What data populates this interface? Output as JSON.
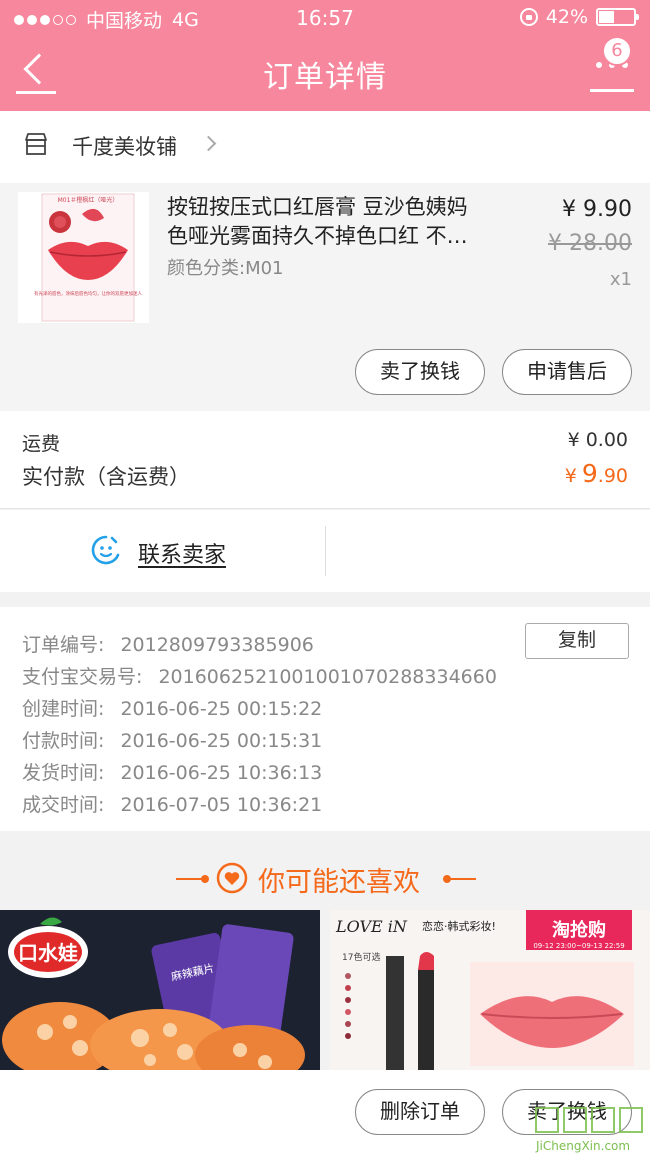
{
  "status_bar": {
    "carrier": "中国移动",
    "network": "4G",
    "time": "16:57",
    "battery": "42%",
    "battery_level": 0.42
  },
  "nav": {
    "title": "订单详情",
    "badge_count": "6"
  },
  "shop": {
    "name": "千度美妆铺"
  },
  "item": {
    "title_line1": "按钮按压式口红唇膏 豆沙色姨妈",
    "title_line2": "色哑光雾面持久不掉色口红 不…",
    "sku": "颜色分类:M01",
    "price": "¥ 9.90",
    "original_price": "¥ 28.00",
    "quantity": "x1",
    "btn_sell": "卖了换钱",
    "btn_aftersale": "申请售后",
    "thumb_header": "M01＃橙枫红（哑光）",
    "thumb_caption": "有光泽的唇色，涂抹后唇色均匀，让你的双唇更加迷人"
  },
  "fees": {
    "shipping_label": "运费",
    "shipping_value": "¥ 0.00",
    "paid_label": "实付款（含运费）",
    "paid_currency": "¥",
    "paid_int": "9",
    "paid_dec": ".90"
  },
  "contact": {
    "label": "联系卖家"
  },
  "order_info": {
    "copy_label": "复制",
    "rows": [
      {
        "label": "订单编号:",
        "value": "2012809793385906"
      },
      {
        "label": "支付宝交易号:",
        "value": "2016062521001001070288334660"
      },
      {
        "label": "创建时间:",
        "value": "2016-06-25 00:15:22"
      },
      {
        "label": "付款时间:",
        "value": "2016-06-25 00:15:31"
      },
      {
        "label": "发货时间:",
        "value": "2016-06-25 10:36:13"
      },
      {
        "label": "成交时间:",
        "value": "2016-07-05 10:36:21"
      }
    ]
  },
  "recommend": {
    "title": "你可能还喜欢",
    "p1": {
      "brand": "口水娃",
      "pack_text": "麻辣藕片"
    },
    "p2": {
      "brand": "LOVE iN",
      "slogan": "恋恋·韩式彩妆!",
      "sub": "17色可选",
      "tag": "淘抢购",
      "tag_time": "09-12 23:00~09-13 22:59"
    }
  },
  "bottom_bar": {
    "btn_delete": "删除订单",
    "btn_sell": "卖了换钱"
  },
  "watermark": {
    "text": "JiChengXin.com"
  },
  "colors": {
    "nav": "#f7879d",
    "accent": "#f5691b"
  }
}
